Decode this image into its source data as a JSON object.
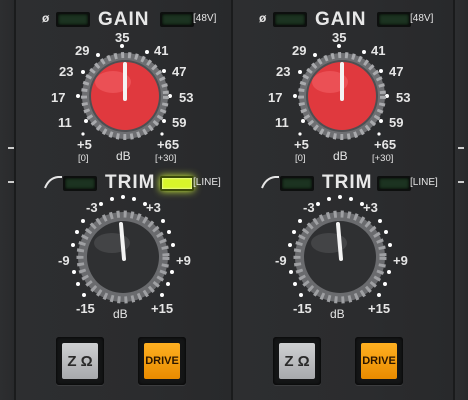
{
  "channels": [
    {
      "phase_symbol": "ø",
      "gain": {
        "title": "GAIN",
        "phantom_label": "[48V]",
        "scale": [
          "+5",
          "11",
          "17",
          "23",
          "29",
          "35",
          "41",
          "47",
          "53",
          "59",
          "+65"
        ],
        "min_sub": "[0]",
        "max_sub": "[+30]",
        "unit": "dB",
        "knob_color": "#e0393e"
      },
      "trim": {
        "title": "TRIM",
        "line_label": "[LINE]",
        "line_led_on": true,
        "scale": [
          "-15",
          "-9",
          "-3",
          "+3",
          "+9",
          "+15"
        ],
        "unit": "dB",
        "knob_color": "#2f3032"
      },
      "buttons": {
        "impedance": "Z Ω",
        "drive": "DRIVE"
      }
    },
    {
      "phase_symbol": "ø",
      "gain": {
        "title": "GAIN",
        "phantom_label": "[48V]",
        "scale": [
          "+5",
          "11",
          "17",
          "23",
          "29",
          "35",
          "41",
          "47",
          "53",
          "59",
          "+65"
        ],
        "min_sub": "[0]",
        "max_sub": "[+30]",
        "unit": "dB",
        "knob_color": "#e0393e"
      },
      "trim": {
        "title": "TRIM",
        "line_label": "[LINE]",
        "line_led_on": false,
        "scale": [
          "-15",
          "-9",
          "-3",
          "+3",
          "+9",
          "+15"
        ],
        "unit": "dB",
        "knob_color": "#2f3032"
      },
      "buttons": {
        "impedance": "Z Ω",
        "drive": "DRIVE"
      }
    }
  ],
  "colors": {
    "panel": "#2b2c2e",
    "led_off": "#1c3321",
    "led_on": "#d7f52a",
    "drive_button": "#f29c0a",
    "impedance_button": "#b9babc"
  }
}
